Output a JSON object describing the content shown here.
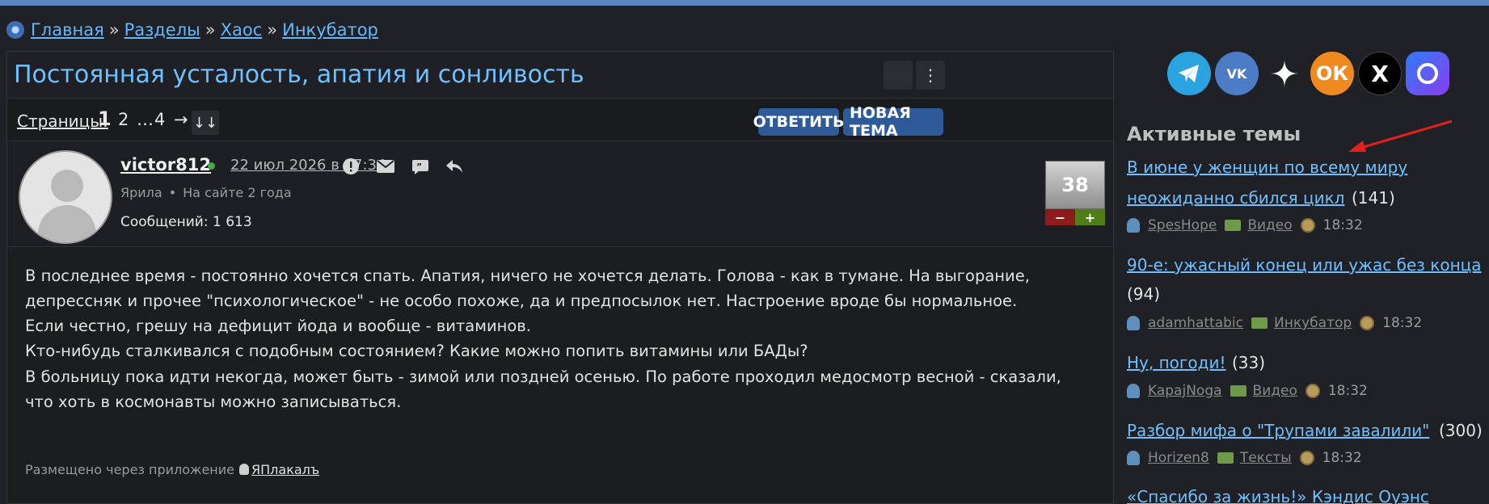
{
  "breadcrumb": {
    "items": [
      "Главная",
      "Разделы",
      "Хаос",
      "Инкубатор"
    ],
    "separator": "»"
  },
  "topic": {
    "title": "Постоянная усталость, апатия и сонливость",
    "more_button": "⋮"
  },
  "pager": {
    "label": "Страницы:",
    "current": "1",
    "pages": [
      "2",
      "…",
      "4"
    ],
    "next": "→",
    "jump": "↓↓",
    "reply_button": "ОТВЕТИТЬ",
    "new_topic_button": "НОВАЯ ТЕМА"
  },
  "post": {
    "username": "victor812",
    "date": "22 июл 2026 в 17:34",
    "rank": "Ярила",
    "meta_sep": "•",
    "on_site": "На сайте 2 года",
    "messages": "Сообщений: 1 613",
    "rating": "38",
    "minus": "−",
    "plus": "+",
    "lines": [
      "В последнее время - постоянно хочется спать. Апатия, ничего не хочется делать. Голова - как в тумане. На выгорание,",
      "депрессняк и прочее \"психологическое\" - не особо похоже, да и предпосылок нет. Настроение вроде бы нормальное.",
      "Если честно, грешу на дефицит йода и вообще - витаминов.",
      "Кто-нибудь сталкивался с подобным состоянием? Какие можно попить витамины или БАДы?",
      "В больницу пока идти некогда, может быть - зимой или поздней осенью. По работе проходил медосмотр весной - сказали,",
      "что хоть в космонавты можно записываться."
    ],
    "posted_via_label": "Размещено через приложение",
    "posted_via_app": "ЯПлакалъ"
  },
  "sidebar": {
    "socials": [
      "telegram-icon",
      "vk-icon",
      "dzen-icon",
      "ok-icon",
      "x-icon",
      "max-icon"
    ],
    "vk_label": "VK",
    "ok_label": "ОК",
    "x_label": "X",
    "title": "Активные темы",
    "topics": [
      {
        "line1": "В июне у женщин по всему миру",
        "line2": "неожиданно сбился цикл",
        "count": "(141)",
        "user": "SpesHope",
        "section": "Видео",
        "time": "18:32"
      },
      {
        "line1": "90-е: ужасный конец или ужас без конца",
        "count": "(94)",
        "user": "adamhattabic",
        "section": "Инкубатор",
        "time": "18:32"
      },
      {
        "line1": "Ну, погоди!",
        "count": "(33)",
        "user": "KapajNoga",
        "section": "Видео",
        "time": "18:32"
      },
      {
        "line1": "Разбор мифа о \"Трупами завалили\"",
        "count": "(300)",
        "user": "Horizen8",
        "section": "Тексты",
        "time": "18:32"
      },
      {
        "line1": "«Спасибо за жизнь!» Кэндис Оуэнс"
      }
    ]
  }
}
